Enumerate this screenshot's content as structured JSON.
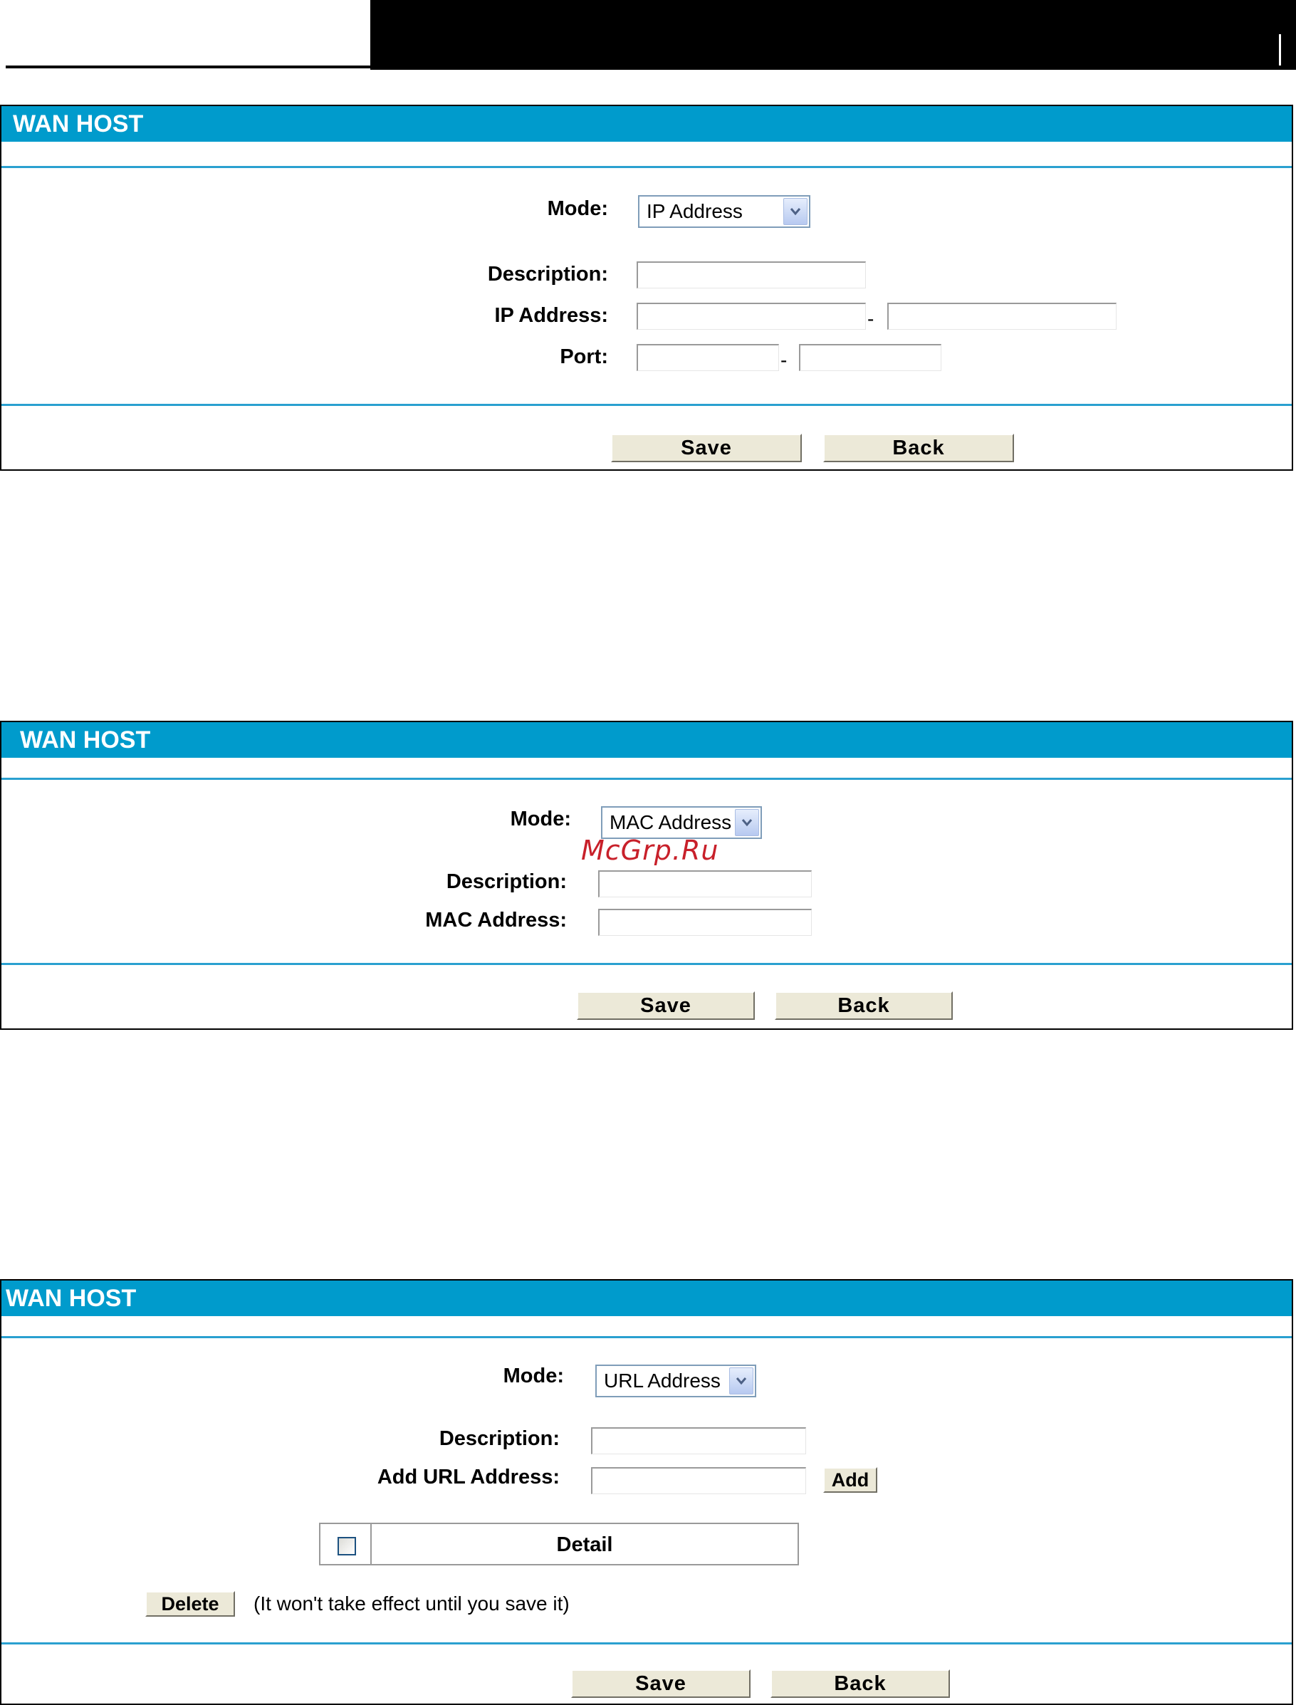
{
  "panels": {
    "ip": {
      "title": "WAN HOST",
      "mode_label": "Mode:",
      "mode_value": "IP Address",
      "description_label": "Description:",
      "ip_label": "IP Address:",
      "port_label": "Port:",
      "range_separator": "-",
      "save_label": "Save",
      "back_label": "Back"
    },
    "mac": {
      "title": "WAN HOST",
      "mode_label": "Mode:",
      "mode_value": "MAC Address",
      "description_label": "Description:",
      "mac_label": "MAC Address:",
      "save_label": "Save",
      "back_label": "Back"
    },
    "url": {
      "title": "WAN HOST",
      "mode_label": "Mode:",
      "mode_value": "URL Address",
      "description_label": "Description:",
      "add_url_label": "Add URL Address:",
      "add_label": "Add",
      "detail_header": "Detail",
      "delete_label": "Delete",
      "delete_note": "(It won't take effect until you save it)",
      "save_label": "Save",
      "back_label": "Back"
    }
  },
  "watermark": "McGrp.Ru",
  "colors": {
    "title_bar": "#009bcc",
    "rule": "#2aa0d0",
    "button_face": "#ece9d8",
    "watermark": "#c8202a"
  },
  "icons": {
    "dropdown": "chevron-down-icon",
    "checkbox": "checkbox-unchecked"
  }
}
